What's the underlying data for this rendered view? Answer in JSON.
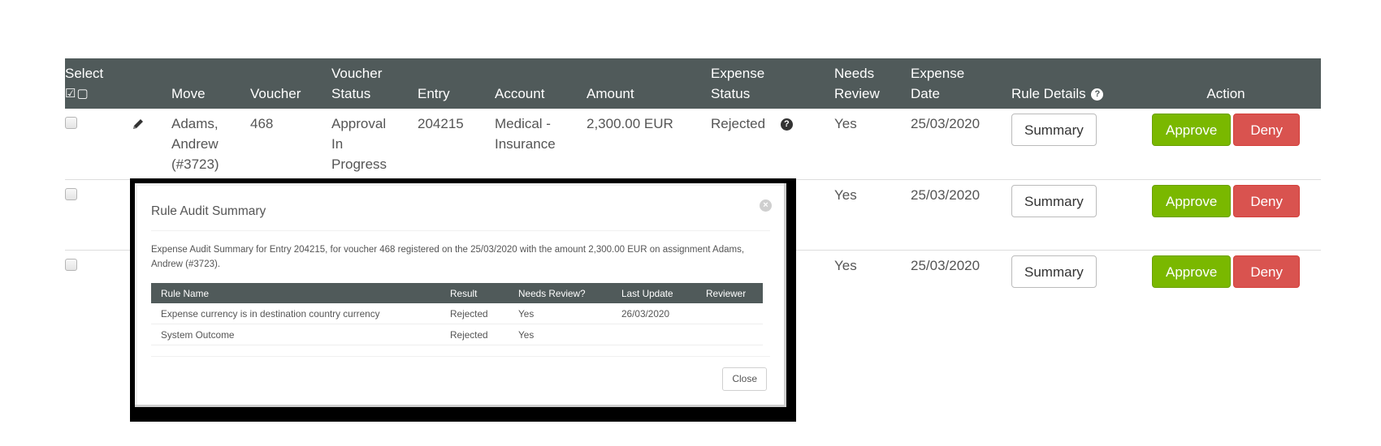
{
  "table": {
    "headers": {
      "select": "Select",
      "select_icons": "☑▢",
      "move": "Move",
      "voucher": "Voucher",
      "voucher_status_1": "Voucher",
      "voucher_status_2": "Status",
      "entry": "Entry",
      "account": "Account",
      "amount": "Amount",
      "expense_status_1": "Expense",
      "expense_status_2": "Status",
      "needs_review_1": "Needs",
      "needs_review_2": "Review",
      "expense_date_1": "Expense",
      "expense_date_2": "Date",
      "rule_details": "Rule Details",
      "action": "Action"
    },
    "rows": [
      {
        "move_1": "Adams,",
        "move_2": "Andrew",
        "move_3": "(#3723)",
        "voucher": "468",
        "voucher_status_1": "Approval",
        "voucher_status_2": "In",
        "voucher_status_3": "Progress",
        "entry": "204215",
        "account_1": "Medical -",
        "account_2": "Insurance",
        "amount": "2,300.00 EUR",
        "expense_status": "Rejected",
        "needs_review": "Yes",
        "expense_date": "25/03/2020",
        "summary_label": "Summary",
        "approve_label": "Approve",
        "deny_label": "Deny"
      },
      {
        "needs_review": "Yes",
        "expense_date": "25/03/2020",
        "summary_label": "Summary",
        "approve_label": "Approve",
        "deny_label": "Deny"
      },
      {
        "needs_review": "Yes",
        "expense_date": "25/03/2020",
        "summary_label": "Summary",
        "approve_label": "Approve",
        "deny_label": "Deny"
      }
    ]
  },
  "modal": {
    "title": "Rule Audit Summary",
    "description": "Expense Audit Summary for Entry 204215, for voucher 468 registered on the 25/03/2020 with the amount 2,300.00 EUR on assignment Adams, Andrew (#3723).",
    "columns": [
      "Rule Name",
      "Result",
      "Needs Review?",
      "Last Update",
      "Reviewer"
    ],
    "rules": [
      {
        "name": "Expense currency is in destination country currency",
        "result": "Rejected",
        "needs_review": "Yes",
        "last_update": "26/03/2020",
        "reviewer": ""
      },
      {
        "name": "System Outcome",
        "result": "Rejected",
        "needs_review": "Yes",
        "last_update": "",
        "reviewer": ""
      }
    ],
    "close_label": "Close",
    "result_color": "#f5b04a"
  },
  "colors": {
    "header_bg": "#505a5a",
    "approve": "#7ab800",
    "deny": "#d9534f"
  }
}
